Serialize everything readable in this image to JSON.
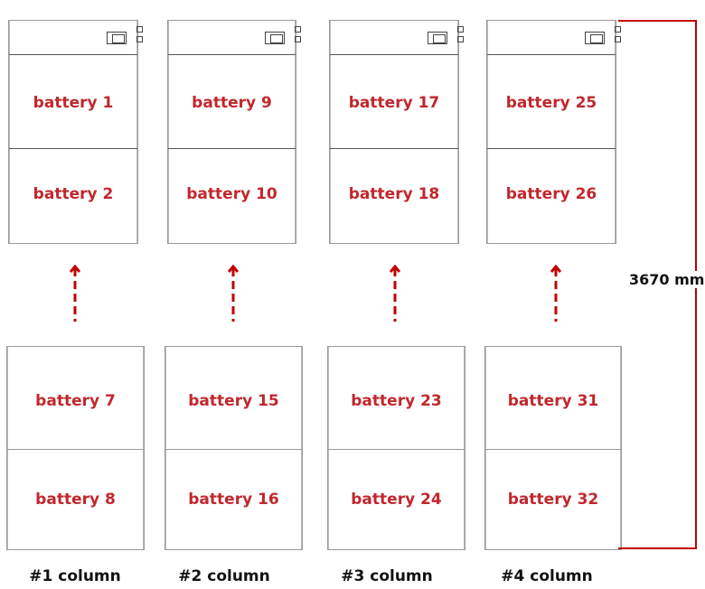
{
  "columns": [
    {
      "label": "#1 column",
      "top": [
        "battery 1",
        "battery 2"
      ],
      "bottom": [
        "battery 7",
        "battery 8"
      ]
    },
    {
      "label": "#2 column",
      "top": [
        "battery 9",
        "battery 10"
      ],
      "bottom": [
        "battery 15",
        "battery 16"
      ]
    },
    {
      "label": "#3 column",
      "top": [
        "battery 17",
        "battery 18"
      ],
      "bottom": [
        "battery 23",
        "battery 24"
      ]
    },
    {
      "label": "#4 column",
      "top": [
        "battery 25",
        "battery 26"
      ],
      "bottom": [
        "battery 31",
        "battery 32"
      ]
    }
  ],
  "dimension": {
    "label": "3670 mm"
  },
  "colors": {
    "label": "#c1272d",
    "arrow": "#c00000"
  }
}
